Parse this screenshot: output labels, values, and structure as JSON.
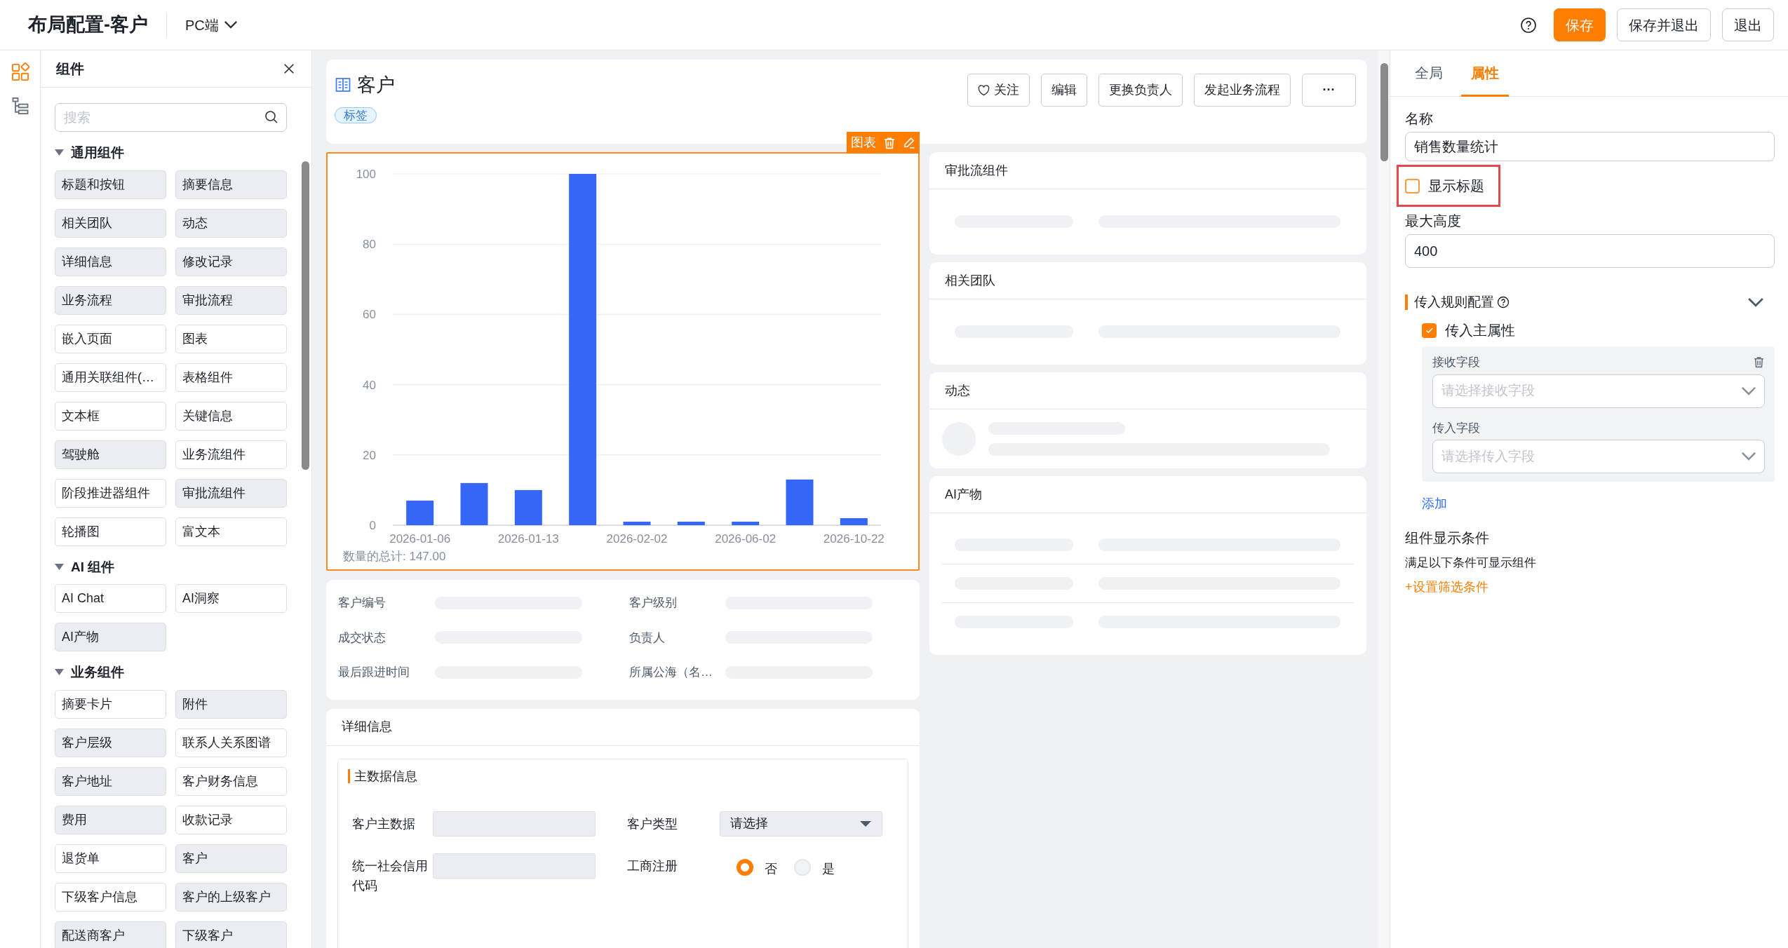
{
  "header": {
    "title": "布局配置-客户",
    "platform": "PC端",
    "buttons": [
      {
        "label": "保存",
        "kind": "primary"
      },
      {
        "label": "保存并退出",
        "kind": "default"
      },
      {
        "label": "退出",
        "kind": "default"
      }
    ]
  },
  "rail": [
    {
      "kind": "components",
      "selected": true
    },
    {
      "kind": "outline",
      "selected": false
    }
  ],
  "component_panel": {
    "title": "组件",
    "search": {
      "placeholder": "搜索"
    },
    "groups": [
      {
        "title": "通用组件",
        "expanded": true,
        "items": [
          {
            "label": "标题和按钮",
            "used": true
          },
          {
            "label": "摘要信息",
            "used": true
          },
          {
            "label": "相关团队",
            "used": true
          },
          {
            "label": "动态",
            "used": true
          },
          {
            "label": "详细信息",
            "used": true
          },
          {
            "label": "修改记录",
            "used": true
          },
          {
            "label": "业务流程",
            "used": true
          },
          {
            "label": "审批流程",
            "used": true
          },
          {
            "label": "嵌入页面",
            "used": false
          },
          {
            "label": "图表",
            "used": false
          },
          {
            "label": "通用关联组件(…",
            "used": false
          },
          {
            "label": "表格组件",
            "used": false
          },
          {
            "label": "文本框",
            "used": false
          },
          {
            "label": "关键信息",
            "used": false
          },
          {
            "label": "驾驶舱",
            "used": true
          },
          {
            "label": "业务流组件",
            "used": false
          },
          {
            "label": "阶段推进器组件",
            "used": false
          },
          {
            "label": "审批流组件",
            "used": true
          },
          {
            "label": "轮播图",
            "used": false
          },
          {
            "label": "富文本",
            "used": false
          }
        ]
      },
      {
        "title": "AI 组件",
        "expanded": true,
        "items": [
          {
            "label": "AI Chat",
            "used": false
          },
          {
            "label": "AI洞察",
            "used": false
          },
          {
            "label": "AI产物",
            "used": true
          }
        ]
      },
      {
        "title": "业务组件",
        "expanded": true,
        "items": [
          {
            "label": "摘要卡片",
            "used": false
          },
          {
            "label": "附件",
            "used": true
          },
          {
            "label": "客户层级",
            "used": true
          },
          {
            "label": "联系人关系图谱",
            "used": false
          },
          {
            "label": "客户地址",
            "used": true
          },
          {
            "label": "客户财务信息",
            "used": false
          },
          {
            "label": "费用",
            "used": true
          },
          {
            "label": "收款记录",
            "used": false
          },
          {
            "label": "退货单",
            "used": false
          },
          {
            "label": "客户",
            "used": true
          },
          {
            "label": "下级客户信息",
            "used": false
          },
          {
            "label": "客户的上级客户",
            "used": true
          },
          {
            "label": "配送商客户",
            "used": true
          },
          {
            "label": "下级客户",
            "used": true
          }
        ]
      }
    ]
  },
  "record": {
    "title": "客户",
    "tag": "标签",
    "actions": [
      {
        "label": "关注",
        "kind": "follow"
      },
      {
        "label": "编辑",
        "kind": "plain"
      },
      {
        "label": "更换负责人",
        "kind": "plain"
      },
      {
        "label": "发起业务流程",
        "kind": "plain"
      },
      {
        "label": "···",
        "kind": "more"
      }
    ]
  },
  "chart_card": {
    "selected": true,
    "toolbar_label": "图表",
    "summary": "数量的总计: 147.00",
    "chart_data": {
      "type": "bar",
      "categories": [
        "2026-01-06",
        null,
        "2026-01-13",
        null,
        "2026-02-02",
        null,
        "2026-06-02",
        null,
        "2026-10-22"
      ],
      "series": [
        {
          "color": "#3566f6",
          "values": [
            7,
            12,
            10,
            100,
            1,
            1,
            1,
            13,
            2
          ]
        }
      ],
      "ylim": [
        0,
        100
      ],
      "yticks": [
        0,
        20,
        40,
        60,
        80,
        100
      ],
      "grid": true
    }
  },
  "summary_fields": [
    {
      "label": "客户编号"
    },
    {
      "label": "客户级别"
    },
    {
      "label": "成交状态"
    },
    {
      "label": "负责人"
    },
    {
      "label": "最后跟进时间"
    },
    {
      "label": "所属公海（名…"
    }
  ],
  "detail_card": {
    "title": "详细信息",
    "section": "主数据信息",
    "fields": [
      {
        "label": "客户主数据",
        "kind": "input"
      },
      {
        "label": "客户类型",
        "kind": "select",
        "value": "请选择"
      },
      {
        "label": "统一社会信用代码",
        "kind": "input"
      },
      {
        "label": "工商注册",
        "kind": "radio",
        "options": [
          {
            "label": "否",
            "selected": true
          },
          {
            "label": "是",
            "selected": false
          }
        ]
      }
    ]
  },
  "side_cards": [
    {
      "title": "审批流组件",
      "kind": "pairs"
    },
    {
      "title": "相关团队",
      "kind": "pairs"
    },
    {
      "title": "动态",
      "kind": "feed"
    },
    {
      "title": "AI产物",
      "kind": "list"
    }
  ],
  "properties": {
    "tabs": [
      {
        "label": "全局",
        "selected": false
      },
      {
        "label": "属性",
        "selected": true
      }
    ],
    "name_label": "名称",
    "name_value": "销售数量统计",
    "show_title": {
      "label": "显示标题",
      "checked": false,
      "highlighted": true
    },
    "max_height_label": "最大高度",
    "max_height_value": "400",
    "rule_section": {
      "title": "传入规则配置",
      "expanded": true,
      "main_attr": {
        "label": "传入主属性",
        "checked": true
      },
      "mappings": [
        {
          "receive_label": "接收字段",
          "receive_placeholder": "请选择接收字段",
          "pass_label": "传入字段",
          "pass_placeholder": "请选择传入字段"
        }
      ],
      "add": "添加"
    },
    "condition": {
      "title": "组件显示条件",
      "hint": "满足以下条件可显示组件",
      "link": "+设置筛选条件"
    }
  }
}
